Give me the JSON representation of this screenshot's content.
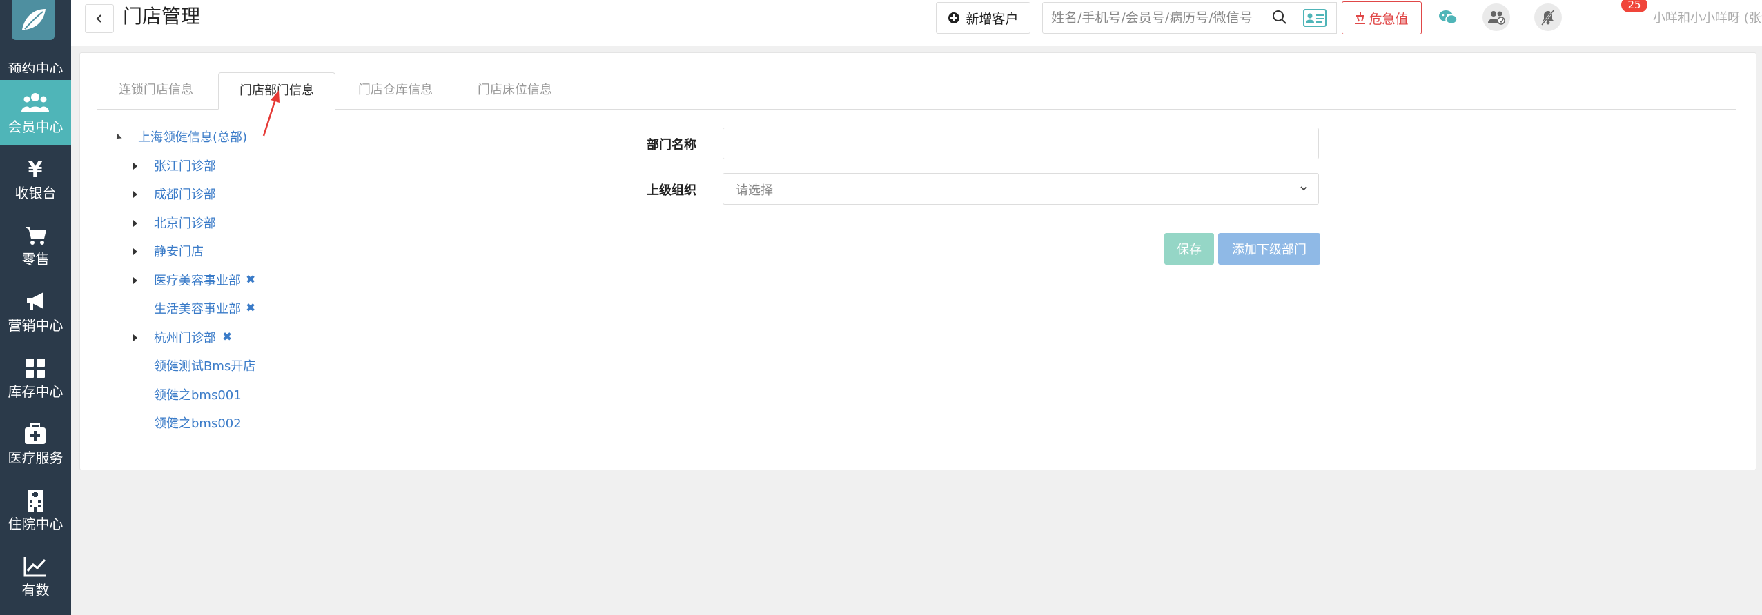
{
  "sidebar": {
    "partial_item_label": "预约中心",
    "items": [
      {
        "label": "会员中心",
        "icon": "users-icon",
        "active": true
      },
      {
        "label": "收银台",
        "icon": "yen-icon",
        "active": false
      },
      {
        "label": "零售",
        "icon": "cart-icon",
        "active": false
      },
      {
        "label": "营销中心",
        "icon": "megaphone-icon",
        "active": false
      },
      {
        "label": "库存中心",
        "icon": "grid-icon",
        "active": false
      },
      {
        "label": "医疗服务",
        "icon": "medkit-icon",
        "active": false
      },
      {
        "label": "住院中心",
        "icon": "hospital-icon",
        "active": false
      },
      {
        "label": "有数",
        "icon": "line-chart-icon",
        "active": false
      }
    ]
  },
  "header": {
    "title": "门店管理",
    "add_customer_label": "新增客户",
    "search_placeholder": "姓名/手机号/会员号/病历号/微信号",
    "danger_label": "危急值",
    "notification_count": "25",
    "user_label": "小咩和小小咩呀 (张江门诊部)"
  },
  "tabs": [
    {
      "label": "连锁门店信息",
      "active": false
    },
    {
      "label": "门店部门信息",
      "active": true
    },
    {
      "label": "门店仓库信息",
      "active": false
    },
    {
      "label": "门店床位信息",
      "active": false
    }
  ],
  "tree": {
    "root": "上海领健信息(总部)",
    "children": [
      {
        "label": "张江门诊部",
        "expandable": true,
        "deletable": false
      },
      {
        "label": "成都门诊部",
        "expandable": true,
        "deletable": false
      },
      {
        "label": "北京门诊部",
        "expandable": true,
        "deletable": false
      },
      {
        "label": "静安门店",
        "expandable": true,
        "deletable": false
      },
      {
        "label": "医疗美容事业部",
        "expandable": true,
        "deletable": true
      },
      {
        "label": "生活美容事业部",
        "expandable": false,
        "deletable": true
      },
      {
        "label": "杭州门诊部",
        "expandable": true,
        "deletable": true
      },
      {
        "label": "领健测试Bms开店",
        "expandable": false,
        "deletable": false
      },
      {
        "label": "领健之bms001",
        "expandable": false,
        "deletable": false
      },
      {
        "label": "领健之bms002",
        "expandable": false,
        "deletable": false
      }
    ]
  },
  "form": {
    "dept_name_label": "部门名称",
    "dept_name_value": "",
    "parent_org_label": "上级组织",
    "parent_org_placeholder": "请选择",
    "save_label": "保存",
    "add_sub_label": "添加下级部门"
  },
  "colors": {
    "sidebar_bg": "#2b3a4a",
    "sidebar_active": "#4fb5b8",
    "link_blue": "#3a7bc8",
    "danger_red": "#e04848",
    "save_green": "#95d6c6",
    "add_blue": "#8fb9e6"
  }
}
